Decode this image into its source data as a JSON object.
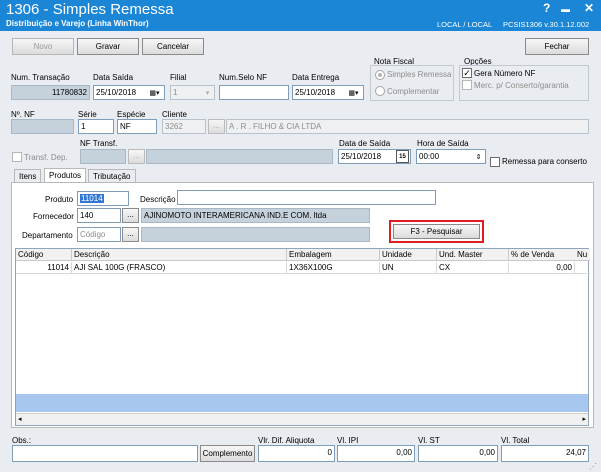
{
  "window": {
    "title": "1306 - Simples Remessa",
    "subtitle": "Distribuição e Varejo (Linha WinThor)",
    "location": "LOCAL / LOCAL",
    "version": "PCSIS1306  v.30.1.12.002",
    "controls": {
      "help": "?",
      "minimize": "▬",
      "close": "✕"
    }
  },
  "toolbar": {
    "novo": "Novo",
    "gravar": "Gravar",
    "cancelar": "Cancelar",
    "fechar": "Fechar"
  },
  "header": {
    "num_transacao_label": "Num. Transação",
    "num_transacao": "11780832",
    "data_saida_label": "Data Saída",
    "data_saida": "25/10/2018",
    "filial_label": "Filial",
    "filial": "1",
    "num_selo_label": "Num.Selo NF",
    "num_selo": "",
    "data_entrega_label": "Data Entrega",
    "data_entrega": "25/10/2018",
    "nota_fiscal_label": "Nota Fiscal",
    "nf_simples": "Simples Remessa",
    "nf_complementar": "Complementar",
    "opcoes_label": "Opções",
    "gera_numero_nf": "Gera Número NF",
    "merc_consert": "Merc. p/ Conserto/garantia",
    "num_nf_label": "Nº. NF",
    "num_nf": "",
    "serie_label": "Série",
    "serie": "1",
    "especie_label": "Espécie",
    "especie": "NF",
    "cliente_label": "Cliente",
    "cliente_cod": "3262",
    "cliente_nome": "A . R . FILHO & CIA LTDA",
    "transf_dep": "Transf. Dep.",
    "nf_transf_label": "NF Transf.",
    "data_de_saida_label": "Data de Saída",
    "data_de_saida": "25/10/2018",
    "hora_saida_label": "Hora de Saída",
    "hora_saida": "00:00",
    "remessa_conserto": "Remessa para conserto",
    "calendar_day": "15"
  },
  "tabs": [
    {
      "label": "Itens"
    },
    {
      "label": "Produtos"
    },
    {
      "label": "Tributação"
    }
  ],
  "produtos": {
    "produto_label": "Produto",
    "produto": "11014",
    "descricao_label": "Descrição",
    "descricao": "",
    "fornecedor_label": "Fornecedor",
    "fornecedor_cod": "140",
    "fornecedor_nome": "AJINOMOTO INTERAMERICANA IND.E COM. ltda",
    "departamento_label": "Departamento",
    "departamento_placeholder": "Código",
    "departamento_nome": "",
    "pesquisar": "F3 - Pesquisar",
    "dots": "..."
  },
  "grid": {
    "columns": [
      "Código",
      "Descrição",
      "Embalagem",
      "Unidade",
      "Und. Master",
      "% de Venda",
      "Nu"
    ],
    "rows": [
      [
        "11014",
        "AJI SAL 100G (FRASCO)",
        "1X36X100G",
        "UN",
        "CX",
        "0,00",
        ""
      ]
    ]
  },
  "footer": {
    "obs_label": "Obs.:",
    "obs": "",
    "complemento": "Complemento",
    "vl_dif_label": "Vlr. Dif. Aliquota",
    "vl_dif": "0",
    "vl_ipi_label": "Vl. IPI",
    "vl_ipi": "0,00",
    "vl_st_label": "Vl. ST",
    "vl_st": "0,00",
    "vl_total_label": "Vl. Total",
    "vl_total": "24,07"
  },
  "colors": {
    "titlebar": "#1b86d6",
    "highlight": "#e01b24",
    "readonly": "#c5d2dc"
  }
}
